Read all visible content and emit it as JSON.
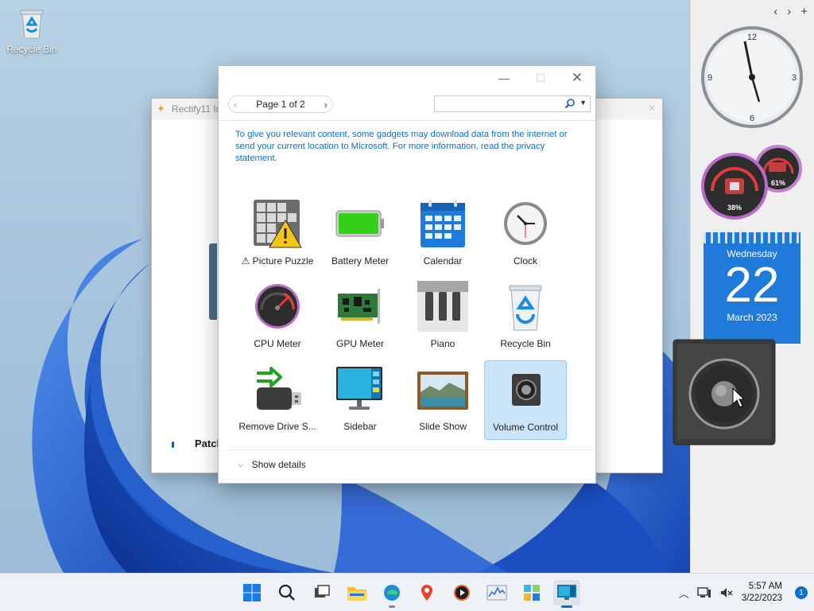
{
  "desktop": {
    "recycle_bin_label": "Recycle Bin"
  },
  "background_window": {
    "title": "Rectify11 In",
    "partial_text": "Patch"
  },
  "dialog": {
    "pager": {
      "text": "Page 1 of 2",
      "prev_icon": "chevron-left-icon",
      "next_icon": "chevron-right-icon"
    },
    "search": {
      "value": "",
      "icon": "search-icon"
    },
    "privacy_text": "To give you relevant content, some gadgets may download data from the internet or send your current location to Microsoft. For more information, read the privacy statement.",
    "gadgets": [
      {
        "name": "⚠ Picture Puzzle",
        "icon": "picture-puzzle-icon"
      },
      {
        "name": "Battery Meter",
        "icon": "battery-icon"
      },
      {
        "name": "Calendar",
        "icon": "calendar-icon"
      },
      {
        "name": "Clock",
        "icon": "clock-icon"
      },
      {
        "name": "CPU Meter",
        "icon": "cpu-meter-icon"
      },
      {
        "name": "GPU Meter",
        "icon": "gpu-card-icon"
      },
      {
        "name": "Piano",
        "icon": "piano-icon"
      },
      {
        "name": "Recycle Bin",
        "icon": "recycle-bin-icon"
      },
      {
        "name": "Remove Drive S...",
        "icon": "usb-drive-icon"
      },
      {
        "name": "Sidebar",
        "icon": "monitor-icon"
      },
      {
        "name": "Slide Show",
        "icon": "slideshow-icon"
      },
      {
        "name": "Volume Control",
        "icon": "speaker-icon",
        "selected": true
      }
    ],
    "show_details_label": "Show details"
  },
  "sidebar": {
    "clock": {
      "numerals": [
        "12",
        "3",
        "6",
        "9"
      ]
    },
    "cpu_meter": {
      "cpu_percent": "38%",
      "memory_percent": "61%"
    },
    "calendar": {
      "weekday": "Wednesday",
      "day": "22",
      "month_year": "March 2023"
    }
  },
  "taskbar": {
    "time": "5:57 AM",
    "date": "3/22/2023",
    "notification_count": "1"
  },
  "colors": {
    "accent": "#0b6fd1",
    "link": "#0b6fc4",
    "selection": "#cce4f7",
    "wallpaper_blue": "#1f5fd1"
  }
}
